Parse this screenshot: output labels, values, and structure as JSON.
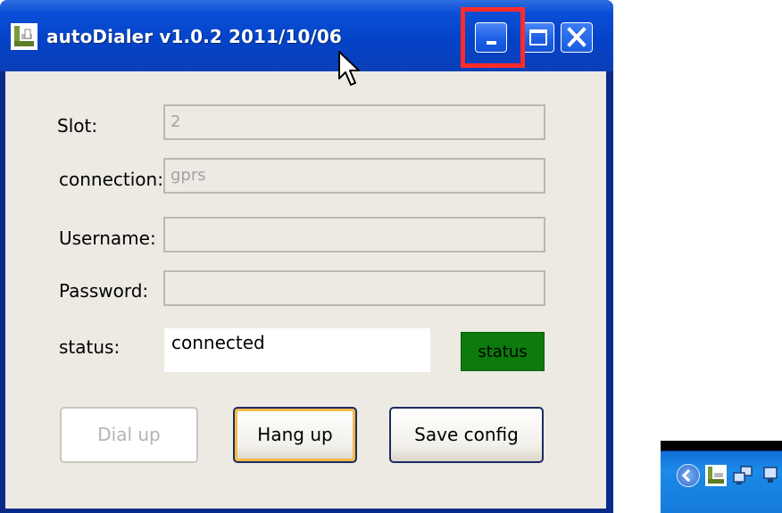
{
  "window": {
    "title": "autoDialer v1.0.2 2011/10/06"
  },
  "form": {
    "slot": {
      "label": "Slot:",
      "value": "2"
    },
    "connection": {
      "label": "connection:",
      "value": "gprs"
    },
    "username": {
      "label": "Username:",
      "value": ""
    },
    "password": {
      "label": "Password:",
      "value": ""
    },
    "status": {
      "label": "status:",
      "value": "connected",
      "indicator_label": "status",
      "indicator_color": "#0c7a0c"
    }
  },
  "buttons": {
    "dial_up": "Dial up",
    "hang_up": "Hang up",
    "save_config": "Save config"
  },
  "annotation": {
    "highlight_color": "#ff2b2b"
  },
  "taskbar": {
    "tray_icons": [
      "show-hidden-icons-icon",
      "autodialer-tray-icon",
      "network-connections-icon",
      "network-icon"
    ]
  }
}
